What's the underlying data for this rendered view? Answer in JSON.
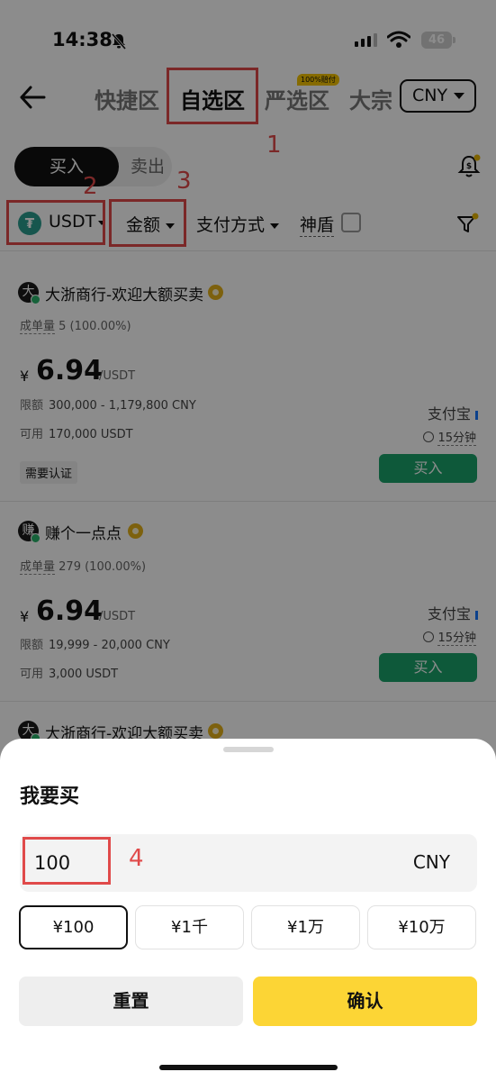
{
  "status_bar": {
    "time": "14:38",
    "battery": "46"
  },
  "nav": {
    "tabs": [
      {
        "label": "快捷区",
        "active": false
      },
      {
        "label": "自选区",
        "active": true
      },
      {
        "label": "严选区",
        "active": false,
        "badge": "100%赔付"
      },
      {
        "label": "大宗",
        "active": false
      }
    ],
    "currency": "CNY"
  },
  "trade_toggle": {
    "buy_label": "买入",
    "sell_label": "卖出",
    "selected": "buy"
  },
  "filters": {
    "coin": "USDT",
    "amount": "金额",
    "payment": "支付方式",
    "shield": "神盾"
  },
  "listings": [
    {
      "avatar": "大",
      "merchant": "大浙商行-欢迎大额买卖",
      "orders_key": "成单量",
      "orders_value": "5 (100.00%)",
      "yen": "¥",
      "price": "6.94",
      "unit": "/USDT",
      "limit_key": "限额",
      "limit_value": "300,000 - 1,179,800 CNY",
      "avail_key": "可用",
      "avail_value": "170,000 USDT",
      "payment": "支付宝",
      "time_limit": "15分钟",
      "tag": "需要认证",
      "buy_label": "买入"
    },
    {
      "avatar": "赚",
      "merchant": "赚个一点点",
      "orders_key": "成单量",
      "orders_value": "279 (100.00%)",
      "yen": "¥",
      "price": "6.94",
      "unit": "/USDT",
      "limit_key": "限额",
      "limit_value": "19,999 - 20,000 CNY",
      "avail_key": "可用",
      "avail_value": "3,000 USDT",
      "payment": "支付宝",
      "time_limit": "15分钟",
      "buy_label": "买入"
    },
    {
      "avatar": "大",
      "merchant": "大浙商行-欢迎大额买卖"
    }
  ],
  "sheet": {
    "title": "我要买",
    "amount_value": "100",
    "currency": "CNY",
    "quick_amounts": [
      "¥100",
      "¥1千",
      "¥1万",
      "¥10万"
    ],
    "selected_quick": 0,
    "reset_label": "重置",
    "confirm_label": "确认"
  },
  "annotations": [
    "1",
    "2",
    "3",
    "4"
  ],
  "colors": {
    "accent_yellow": "#fcd535",
    "buy_green": "#1aa36a",
    "annotation_red": "#e04a4a"
  }
}
